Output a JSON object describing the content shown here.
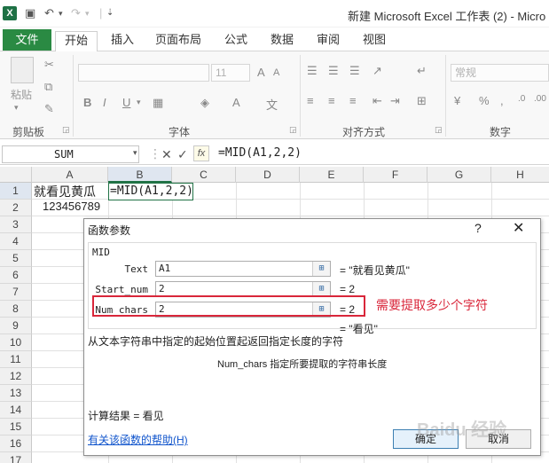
{
  "window": {
    "title": "新建 Microsoft Excel 工作表 (2) - Micro",
    "logo_letter": "X"
  },
  "ribbon": {
    "tabs": [
      "文件",
      "开始",
      "插入",
      "页面布局",
      "公式",
      "数据",
      "审阅",
      "视图"
    ],
    "groups": {
      "clipboard": "剪贴板",
      "font": "字体",
      "alignment": "对齐方式",
      "number": "数字"
    },
    "paste_label": "粘贴",
    "font_size": "11",
    "number_format": "常规",
    "bold": "B",
    "italic": "I",
    "underline": "U"
  },
  "formula_bar": {
    "name_box": "SUM",
    "fx": "fx",
    "formula": "=MID(A1,2,2)"
  },
  "grid": {
    "columns": [
      "A",
      "B",
      "C",
      "D",
      "E",
      "F",
      "G",
      "H"
    ],
    "rows": [
      "1",
      "2",
      "3",
      "4",
      "5",
      "6",
      "7",
      "8",
      "9",
      "10",
      "11",
      "12",
      "13",
      "14",
      "15",
      "16",
      "17",
      "18"
    ],
    "cells": {
      "A1": "就看见黄瓜",
      "B1": "=MID(A1,2,2)",
      "A2": "123456789"
    }
  },
  "dialog": {
    "title": "函数参数",
    "help": "?",
    "close": "✕",
    "function_name": "MID",
    "args": [
      {
        "label": "Text",
        "value": "A1",
        "result": "= \"就看见黄瓜\""
      },
      {
        "label": "Start_num",
        "value": "2",
        "result": "= 2"
      },
      {
        "label": "Num_chars",
        "value": "2",
        "result": "= 2"
      }
    ],
    "overall_result": "= \"看见\"",
    "description": "从文本字符串中指定的起始位置起返回指定长度的字符",
    "arg_description": "Num_chars  指定所要提取的字符串长度",
    "calc_result": "计算结果 = 看见",
    "help_link": "有关该函数的帮助(H)",
    "ok": "确定",
    "cancel": "取消"
  },
  "annotation": "需要提取多少个字符",
  "watermark": "Baidu 经验",
  "colors": {
    "excel_green": "#217346",
    "file_tab": "#2a8a43",
    "annotation_red": "#d9263a"
  }
}
